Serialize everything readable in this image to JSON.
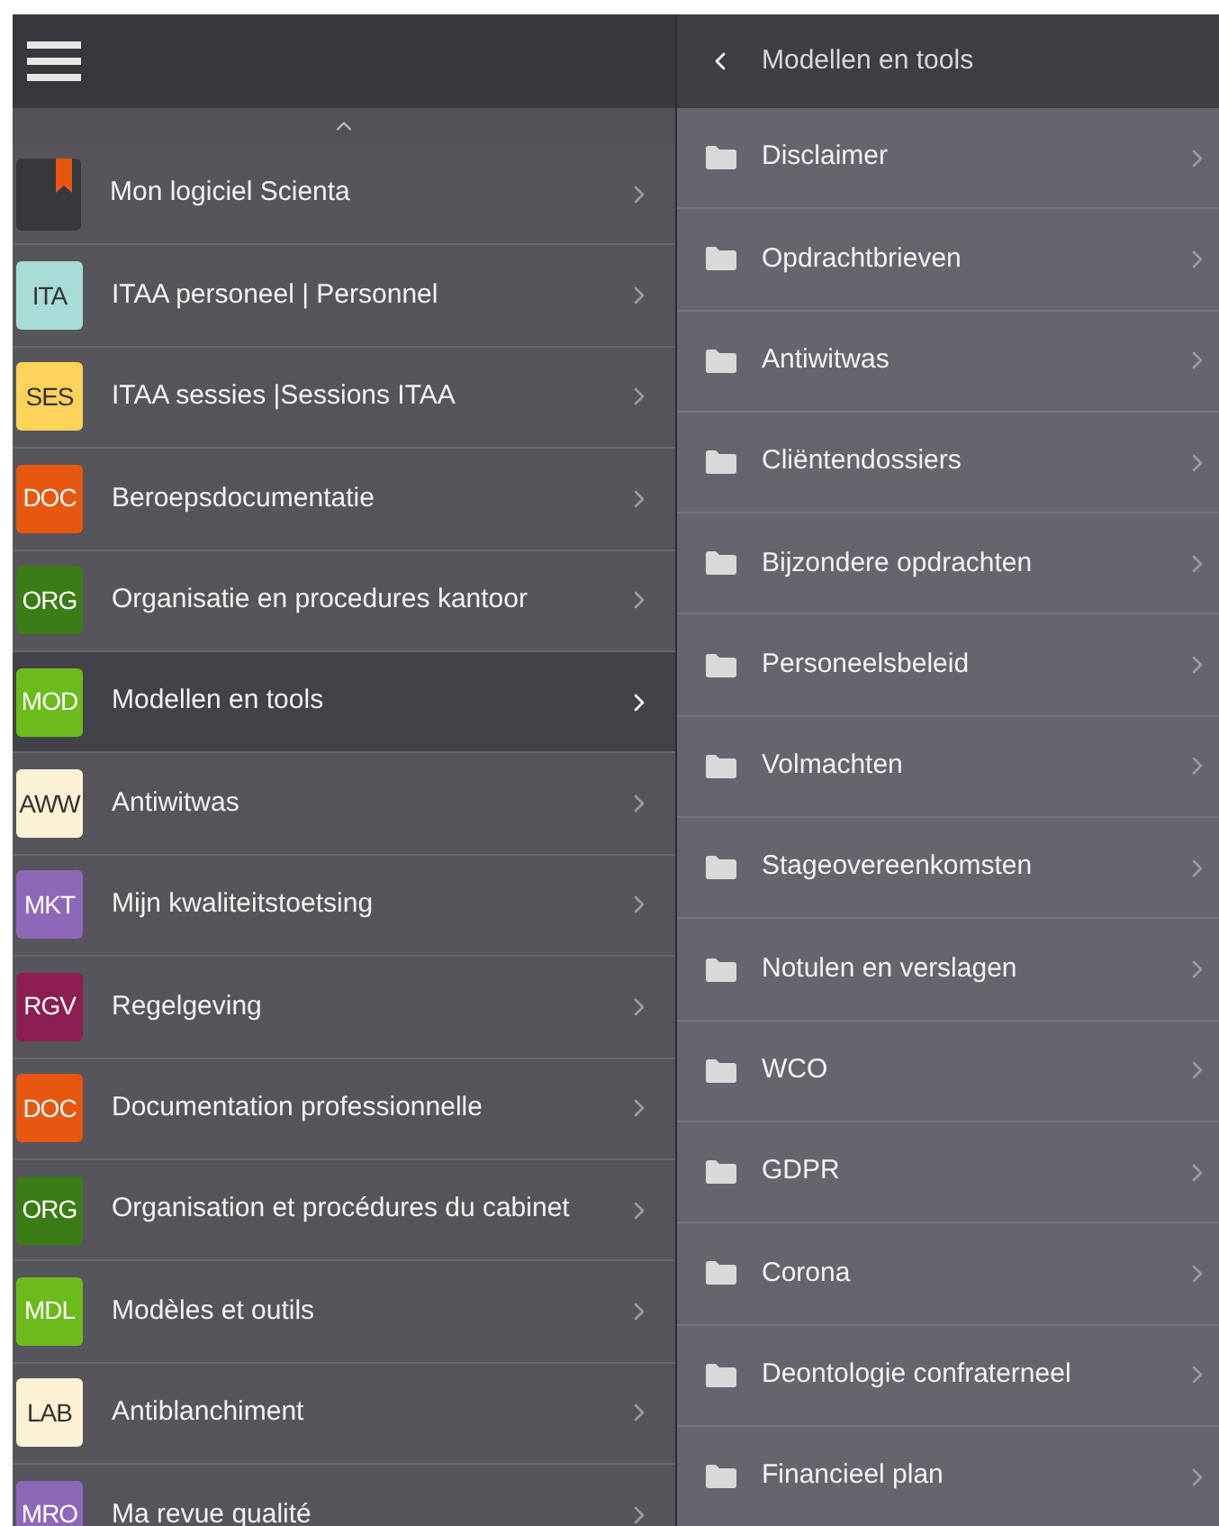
{
  "menu": {
    "items": [
      {
        "kind": "bookmark",
        "label": "Mon logiciel Scienta",
        "selected": false
      },
      {
        "kind": "badge",
        "badge": "ITA",
        "color": "#a8dcd6",
        "label": "ITAA personeel | Personnel",
        "selected": false
      },
      {
        "kind": "badge",
        "badge": "SES",
        "color": "#fdd35a",
        "label": "ITAA sessies |Sessions ITAA",
        "selected": false
      },
      {
        "kind": "badge",
        "badge": "DOC",
        "color": "#e8570f",
        "label": "Beroepsdocumentatie",
        "selected": false
      },
      {
        "kind": "badge",
        "badge": "ORG",
        "color": "#3c7c16",
        "label": "Organisatie en procedures kantoor",
        "selected": false
      },
      {
        "kind": "badge",
        "badge": "MOD",
        "color": "#6cbb1c",
        "label": "Modellen en tools",
        "selected": true
      },
      {
        "kind": "badge",
        "badge": "AWW",
        "color": "#fdf1d3",
        "label": "Antiwitwas",
        "selected": false
      },
      {
        "kind": "badge",
        "badge": "MKT",
        "color": "#8e68b8",
        "label": "Mijn kwaliteitstoetsing",
        "selected": false
      },
      {
        "kind": "badge",
        "badge": "RGV",
        "color": "#8c1e51",
        "label": "Regelgeving",
        "selected": false
      },
      {
        "kind": "badge",
        "badge": "DOC",
        "color": "#e8570f",
        "label": "Documentation professionnelle",
        "selected": false
      },
      {
        "kind": "badge",
        "badge": "ORG",
        "color": "#3c7c16",
        "label": "Organisation et procédures du cabinet",
        "selected": false
      },
      {
        "kind": "badge",
        "badge": "MDL",
        "color": "#6cbb1c",
        "label": "Modèles et outils",
        "selected": false
      },
      {
        "kind": "badge",
        "badge": "LAB",
        "color": "#fdf1d3",
        "label": "Antiblanchiment",
        "selected": false
      },
      {
        "kind": "badge",
        "badge": "MRO",
        "color": "#8e68b8",
        "label": "Ma revue qualité",
        "selected": false
      }
    ]
  },
  "submenu": {
    "title": "Modellen en tools",
    "folders": [
      "Disclaimer",
      "Opdrachtbrieven",
      "Antiwitwas",
      "Cliëntendossiers",
      "Bijzondere opdrachten",
      "Personeelsbeleid",
      "Volmachten",
      "Stageovereenkomsten",
      "Notulen en verslagen",
      "WCO",
      "GDPR",
      "Corona",
      "Deontologie confraterneel",
      "Financieel plan"
    ]
  }
}
